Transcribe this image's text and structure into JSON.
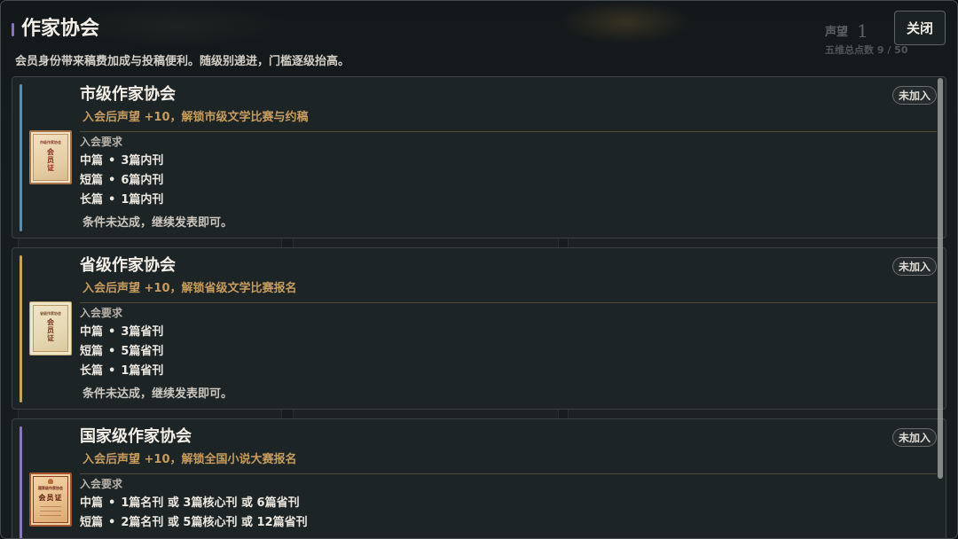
{
  "header": {
    "title": "作家协会",
    "subtitle": "会员身份带来稿费加成与投稿便利。随级别递进，门槛逐级抬高。",
    "close_label": "关闭",
    "title_mark_color": "#8a72c2"
  },
  "backdrop": {
    "reputation_label": "声望",
    "reputation_value": "1",
    "stat_points": "五维总点数 9 / 50"
  },
  "requirement_separator": "•",
  "benefit_color": "#c79c5f",
  "associations": [
    {
      "name": "市级作家协会",
      "status": "未加入",
      "benefit": "入会后声望 +10，解锁市级文学比赛与约稿",
      "requirements_label": "入会要求",
      "requirements": [
        {
          "type": "中篇",
          "condition": "3篇内刊"
        },
        {
          "type": "短篇",
          "condition": "6篇内刊"
        },
        {
          "type": "长篇",
          "condition": "1篇内刊"
        }
      ],
      "progress_note": "条件未达成，继续发表即可。",
      "accent_color": "#5b8db3",
      "certificate": {
        "issuer": "市级作家协会",
        "label": "会员证"
      }
    },
    {
      "name": "省级作家协会",
      "status": "未加入",
      "benefit": "入会后声望 +10，解锁省级文学比赛报名",
      "requirements_label": "入会要求",
      "requirements": [
        {
          "type": "中篇",
          "condition": "3篇省刊"
        },
        {
          "type": "短篇",
          "condition": "5篇省刊"
        },
        {
          "type": "长篇",
          "condition": "1篇省刊"
        }
      ],
      "progress_note": "条件未达成，继续发表即可。",
      "accent_color": "#c9a15e",
      "certificate": {
        "issuer": "省级作家协会",
        "label": "会员证"
      }
    },
    {
      "name": "国家级作家协会",
      "status": "未加入",
      "benefit": "入会后声望 +10，解锁全国小说大赛报名",
      "requirements_label": "入会要求",
      "requirements": [
        {
          "type": "中篇",
          "condition": "1篇名刊 或 3篇核心刊 或 6篇省刊"
        },
        {
          "type": "短篇",
          "condition": "2篇名刊 或 5篇核心刊 或 12篇省刊"
        }
      ],
      "accent_color": "#8b76bd",
      "certificate": {
        "issuer": "国家级作家协会",
        "label": "会员证"
      }
    }
  ]
}
